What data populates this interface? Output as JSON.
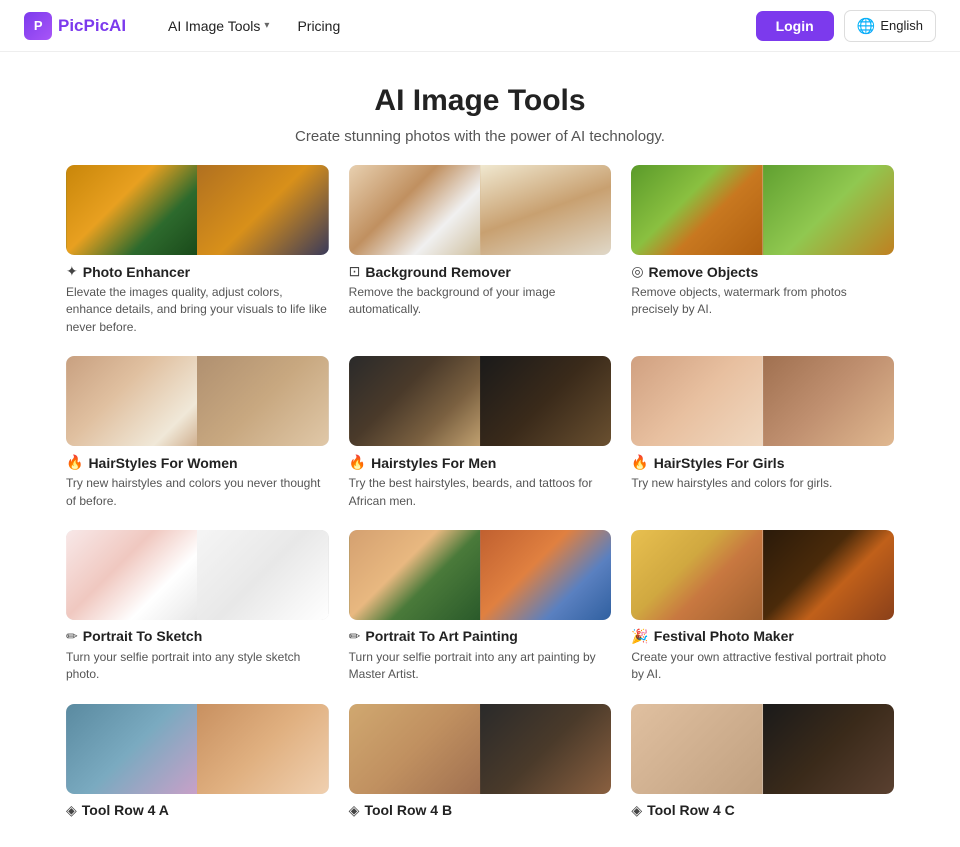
{
  "navbar": {
    "logo_text": "PicPic",
    "logo_ai": "AI",
    "nav_items": [
      {
        "label": "AI Image Tools",
        "has_dropdown": true
      },
      {
        "label": "Pricing",
        "has_dropdown": false
      }
    ],
    "login_label": "Login",
    "lang_label": "English"
  },
  "hero": {
    "title": "AI Image Tools",
    "subtitle": "Create stunning photos with the power of AI technology."
  },
  "tools": [
    {
      "icon": "✦",
      "title": "Photo Enhancer",
      "desc": "Elevate the images quality, adjust colors, enhance details, and bring your visuals to life like never before.",
      "img_left": "img-fox",
      "img_right": "img-fox2"
    },
    {
      "icon": "⊡",
      "title": "Background Remover",
      "desc": "Remove the background of your image automatically.",
      "img_left": "img-girl-curly",
      "img_right": "img-girl-curly2"
    },
    {
      "icon": "◎",
      "title": "Remove Objects",
      "desc": "Remove objects, watermark from photos precisely by AI.",
      "img_left": "img-dog",
      "img_right": "img-dog2"
    },
    {
      "icon": "🔥",
      "title": "HairStyles For Women",
      "desc": "Try new hairstyles and colors you never thought of before.",
      "img_left": "img-woman-blonde",
      "img_right": "img-woman-glasses"
    },
    {
      "icon": "🔥",
      "title": "Hairstyles For Men",
      "desc": "Try the best hairstyles, beards, and tattoos for African men.",
      "img_left": "img-man-dread",
      "img_right": "img-man-dread2"
    },
    {
      "icon": "🔥",
      "title": "HairStyles For Girls",
      "desc": "Try new hairstyles and colors for girls.",
      "img_left": "img-girl-braids",
      "img_right": "img-girl-braids2"
    },
    {
      "icon": "✏",
      "title": "Portrait To Sketch",
      "desc": "Turn your selfie portrait into any style sketch photo.",
      "img_left": "img-woman-sketch",
      "img_right": "img-sketch-drawing"
    },
    {
      "icon": "✏",
      "title": "Portrait To Art Painting",
      "desc": "Turn your selfie portrait into any art painting by Master Artist.",
      "img_left": "img-woman-flowers",
      "img_right": "img-painting"
    },
    {
      "icon": "🎉",
      "title": "Festival Photo Maker",
      "desc": "Create your own attractive festival portrait photo by AI.",
      "img_left": "img-woman-yellow",
      "img_right": "img-goth"
    },
    {
      "icon": "◈",
      "title": "Tool Row 4 A",
      "desc": "",
      "img_left": "img-row4a",
      "img_right": "img-row4b"
    },
    {
      "icon": "◈",
      "title": "Tool Row 4 B",
      "desc": "",
      "img_left": "img-row4c",
      "img_right": "img-row4d"
    },
    {
      "icon": "◈",
      "title": "Tool Row 4 C",
      "desc": "",
      "img_left": "img-row4e",
      "img_right": "img-row4f"
    }
  ]
}
